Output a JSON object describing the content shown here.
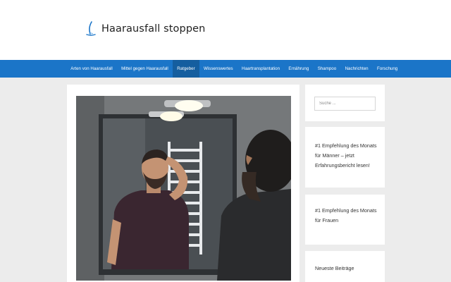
{
  "header": {
    "site_title": "Haarausfall stoppen",
    "logo_icon": "hair-strand-icon"
  },
  "nav": {
    "items": [
      "Arten von Haarausfall",
      "Mittel gegen Haarausfall",
      "Ratgeber",
      "Wissenswertes",
      "Haartransplantation",
      "Ernährung",
      "Shampoo",
      "Nachrichten",
      "Forschung"
    ],
    "active": "Ratgeber"
  },
  "main": {
    "hero_image": "man-checking-hairline-in-bathroom-mirror"
  },
  "sidebar": {
    "search": {
      "placeholder": "Suche ..."
    },
    "ad_men": "#1 Empfehlung des Monats für Männer – jetzt Erfahrungsbericht lesen!",
    "ad_women": "#1 Empfehlung des Monats für Frauen",
    "recent_title": "Neueste Beiträge"
  },
  "colors": {
    "nav_bg": "#1b75c8",
    "nav_active": "#155e9f",
    "page_bg": "#ececec"
  }
}
